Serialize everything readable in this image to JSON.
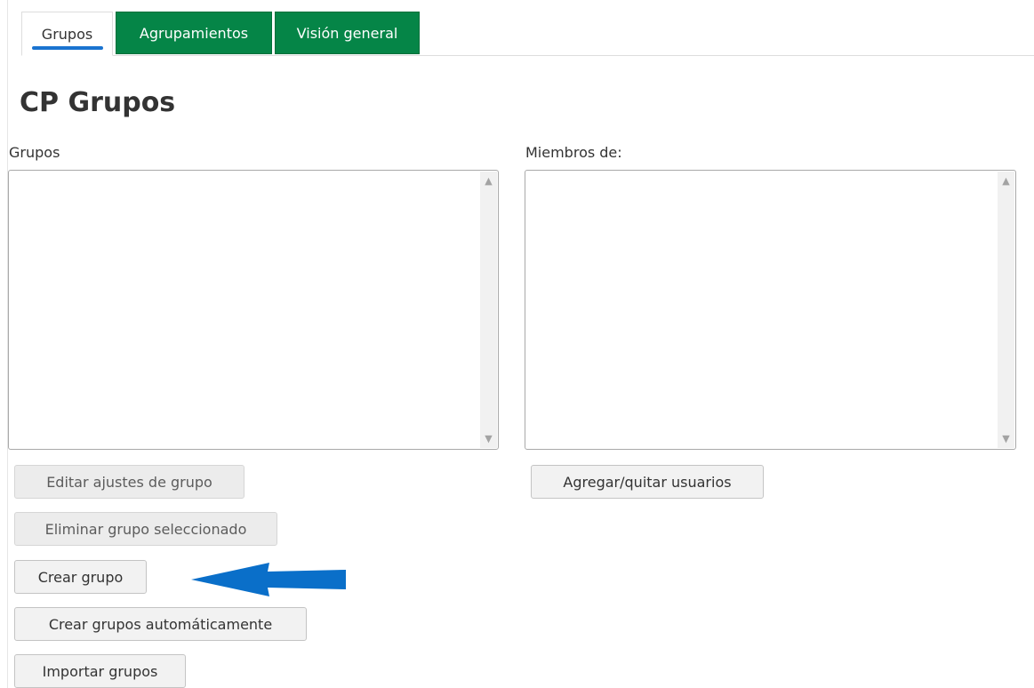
{
  "tabs": [
    {
      "label": "Grupos",
      "active": true
    },
    {
      "label": "Agrupamientos",
      "active": false
    },
    {
      "label": "Visión general",
      "active": false
    }
  ],
  "page_title": "CP Grupos",
  "groups_panel": {
    "label": "Grupos",
    "items": []
  },
  "members_panel": {
    "label": "Miembros de:",
    "items": []
  },
  "buttons": {
    "edit_group": "Editar ajustes de grupo",
    "delete_group": "Eliminar grupo seleccionado",
    "create_group": "Crear grupo",
    "auto_create": "Crear grupos automáticamente",
    "import_groups": "Importar grupos",
    "add_remove_users": "Agregar/quitar usuarios"
  },
  "annotation": {
    "arrow_icon": "left-arrow-icon",
    "arrow_color": "#0a6fc9"
  },
  "colors": {
    "tab_green": "#058547",
    "active_indicator": "#1a73d0"
  }
}
